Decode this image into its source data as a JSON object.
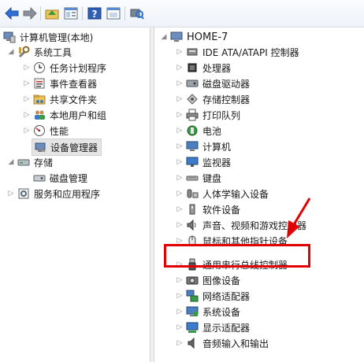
{
  "toolbar": {
    "buttons": [
      "back-arrow-icon",
      "forward-arrow-icon",
      "up-folder-icon",
      "properties-icon",
      "help-icon",
      "view-icon",
      "scan-hardware-icon"
    ]
  },
  "left_tree": [
    {
      "label": "计算机管理(本地)",
      "icon": "computer-management-icon",
      "level": 0,
      "expander": "none"
    },
    {
      "label": "系统工具",
      "icon": "tools-icon",
      "level": 1,
      "expander": "open"
    },
    {
      "label": "任务计划程序",
      "icon": "clock-icon",
      "level": 2,
      "expander": "closed"
    },
    {
      "label": "事件查看器",
      "icon": "event-viewer-icon",
      "level": 2,
      "expander": "closed"
    },
    {
      "label": "共享文件夹",
      "icon": "shared-folder-icon",
      "level": 2,
      "expander": "closed"
    },
    {
      "label": "本地用户和组",
      "icon": "users-icon",
      "level": 2,
      "expander": "closed"
    },
    {
      "label": "性能",
      "icon": "performance-icon",
      "level": 2,
      "expander": "closed"
    },
    {
      "label": "设备管理器",
      "icon": "device-manager-icon",
      "level": 2,
      "expander": "none",
      "selected": true
    },
    {
      "label": "存储",
      "icon": "storage-icon",
      "level": 1,
      "expander": "open"
    },
    {
      "label": "磁盘管理",
      "icon": "disk-management-icon",
      "level": 2,
      "expander": "none"
    },
    {
      "label": "服务和应用程序",
      "icon": "services-icon",
      "level": 1,
      "expander": "closed"
    }
  ],
  "right_tree": {
    "root": {
      "label": "HOME-7",
      "icon": "computer-icon"
    },
    "items": [
      {
        "label": "IDE ATA/ATAPI 控制器",
        "icon": "ide-controller-icon"
      },
      {
        "label": "处理器",
        "icon": "processor-icon"
      },
      {
        "label": "磁盘驱动器",
        "icon": "disk-drive-icon"
      },
      {
        "label": "存储控制器",
        "icon": "storage-controller-icon"
      },
      {
        "label": "打印队列",
        "icon": "printer-icon"
      },
      {
        "label": "电池",
        "icon": "battery-icon"
      },
      {
        "label": "计算机",
        "icon": "computer-icon"
      },
      {
        "label": "监视器",
        "icon": "monitor-icon"
      },
      {
        "label": "键盘",
        "icon": "keyboard-icon"
      },
      {
        "label": "人体学输入设备",
        "icon": "hid-icon"
      },
      {
        "label": "软件设备",
        "icon": "software-device-icon"
      },
      {
        "label": "声音、视频和游戏控制器",
        "icon": "sound-icon"
      },
      {
        "label": "鼠标和其他指针设备",
        "icon": "mouse-icon"
      },
      {
        "label": "通用串行总线控制器",
        "icon": "usb-icon"
      },
      {
        "label": "图像设备",
        "icon": "camera-icon"
      },
      {
        "label": "网络适配器",
        "icon": "network-adapter-icon"
      },
      {
        "label": "系统设备",
        "icon": "system-device-icon"
      },
      {
        "label": "显示适配器",
        "icon": "display-adapter-icon"
      },
      {
        "label": "音频输入和输出",
        "icon": "audio-icon"
      }
    ]
  },
  "annotation": {
    "color": "#e30000",
    "target": "通用串行总线控制器"
  }
}
